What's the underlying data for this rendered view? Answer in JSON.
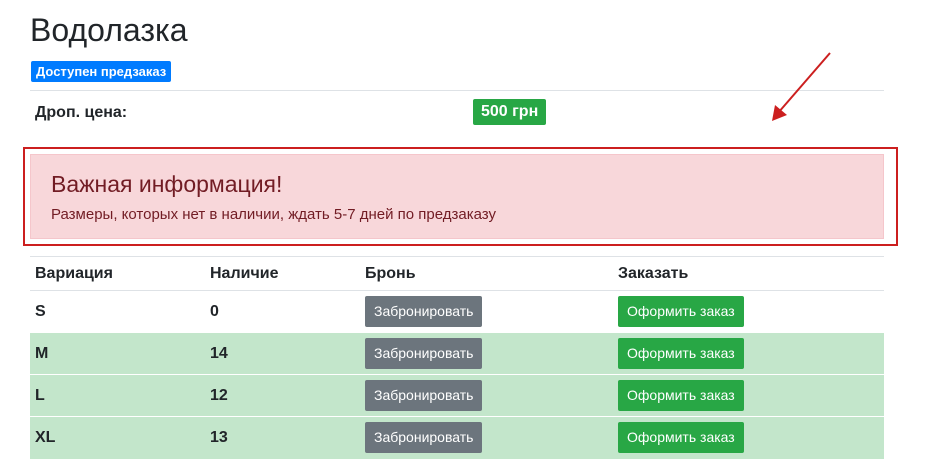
{
  "product": {
    "title": "Водолазка",
    "status_badge": "Доступен предзаказ",
    "price_label": "Дроп. цена:",
    "price_value": "500 грн"
  },
  "alert": {
    "heading": "Важная информация!",
    "text": "Размеры, которых нет в наличии, ждать 5-7 дней по предзаказу"
  },
  "table": {
    "headers": [
      "Вариация",
      "Наличие",
      "Бронь",
      "Заказать"
    ],
    "reserve_label": "Забронировать",
    "order_label": "Оформить заказ",
    "rows": [
      {
        "size": "S",
        "stock": "0"
      },
      {
        "size": "M",
        "stock": "14"
      },
      {
        "size": "L",
        "stock": "12"
      },
      {
        "size": "XL",
        "stock": "13"
      }
    ]
  },
  "colors": {
    "badge_blue": "#007bff",
    "success_green": "#28a745",
    "secondary_gray": "#6c757d",
    "alert_bg": "#f8d7da",
    "alert_text": "#721c24",
    "row_available_bg": "#c3e6cb",
    "annotation_red": "#cc1f1f"
  },
  "icons": {
    "annotation": "red-arrow-icon"
  }
}
